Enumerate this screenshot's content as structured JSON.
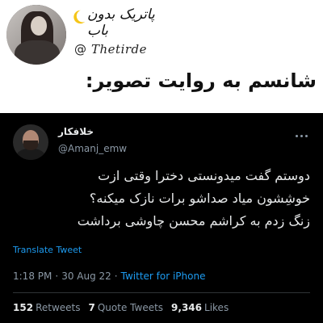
{
  "header": {
    "profile_name": "پاتریک بدون باب",
    "at_symbol": "@",
    "handle": "Thetirde",
    "title": "شانسم به روایت تصویر:"
  },
  "tweet": {
    "author_name": "خلافکار",
    "author_handle": "@Amanj_emw",
    "text_lines": [
      "دوستم گفت میدونستی دخترا وقتی ازت",
      "خوشِشون میاد صداشو برات نازک میکنه؟",
      "زنگ زدم به کراشم محسن چاوشی برداشت"
    ],
    "translate_label": "Translate Tweet",
    "time": "1:18 PM",
    "date": "30 Aug 22",
    "separator": "·",
    "source": "Twitter for iPhone",
    "stats": {
      "retweets_count": "152",
      "retweets_label": "Retweets",
      "quotes_count": "7",
      "quotes_label": "Quote Tweets",
      "likes_count": "9,346",
      "likes_label": "Likes"
    }
  },
  "colors": {
    "card_bg": "#000000",
    "link_blue": "#1d9bf0",
    "muted_text": "#8b98a5",
    "primary_text": "#e7e9ea"
  }
}
